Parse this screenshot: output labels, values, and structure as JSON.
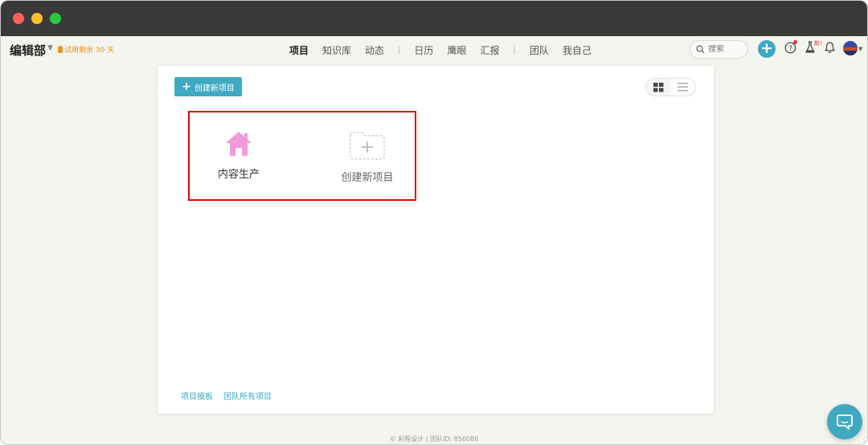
{
  "header": {
    "team_name": "编辑部",
    "trial_text": "试用剩余 30 天"
  },
  "nav": {
    "items": [
      "项目",
      "知识库",
      "动态",
      "日历",
      "鹰眼",
      "汇报",
      "团队",
      "我自己"
    ],
    "active": "项目"
  },
  "search": {
    "placeholder": "搜索"
  },
  "badges": {
    "lab_badge": "新!"
  },
  "toolbar": {
    "create_label": "创建新项目"
  },
  "projects": [
    {
      "name": "内容生产",
      "icon": "home-icon",
      "color": "#f29bd9"
    },
    {
      "name": "创建新项目",
      "icon": "add-folder-icon"
    }
  ],
  "footer_links": [
    "项目模板",
    "团队所有项目"
  ],
  "copyright": "© 彩程设计 | 团队ID: 856086",
  "colors": {
    "accent": "#3fa9c2",
    "highlight": "#e30000",
    "trial": "#f0901e"
  }
}
